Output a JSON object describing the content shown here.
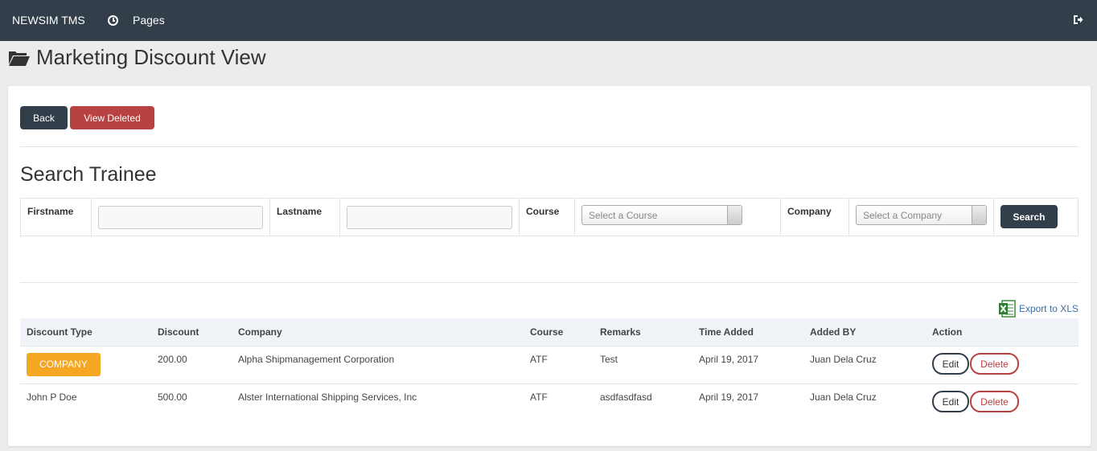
{
  "topbar": {
    "brand": "NEWSIM TMS",
    "pages_label": "Pages",
    "pages_icon": "clock-icon",
    "signout_icon": "sign-out-icon",
    "bg_color": "#333e4b"
  },
  "page": {
    "title": "Marketing Discount View",
    "title_icon": "folder-open-icon"
  },
  "actions": {
    "back_label": "Back",
    "view_deleted_label": "View Deleted"
  },
  "search": {
    "title": "Search Trainee",
    "firstname_label": "Firstname",
    "lastname_label": "Lastname",
    "course_label": "Course",
    "course_placeholder": "Select a Course",
    "company_label": "Company",
    "company_placeholder": "Select a Company",
    "search_label": "Search"
  },
  "export": {
    "label": "Export to XLS",
    "icon": "excel-icon"
  },
  "table": {
    "columns": [
      "Discount Type",
      "Discount",
      "Company",
      "Course",
      "Remarks",
      "Time Added",
      "Added BY",
      "Action"
    ],
    "rows": [
      {
        "discount_type": "COMPANY",
        "discount_type_badge": true,
        "discount": "200.00",
        "company": "Alpha Shipmanagement Corporation",
        "course": "ATF",
        "remarks": "Test",
        "time_added": "April 19, 2017",
        "added_by": "Juan Dela Cruz",
        "edit_label": "Edit",
        "delete_label": "Delete"
      },
      {
        "discount_type": "John P Doe",
        "discount_type_badge": false,
        "discount": "500.00",
        "company": "Alster International Shipping Services, Inc",
        "course": "ATF",
        "remarks": "asdfasdfasd",
        "time_added": "April 19, 2017",
        "added_by": "Juan Dela Cruz",
        "edit_label": "Edit",
        "delete_label": "Delete"
      }
    ]
  },
  "colors": {
    "primary": "#333e4b",
    "danger": "#b84141",
    "badge": "#f5a623",
    "link": "#3a6fa8"
  }
}
